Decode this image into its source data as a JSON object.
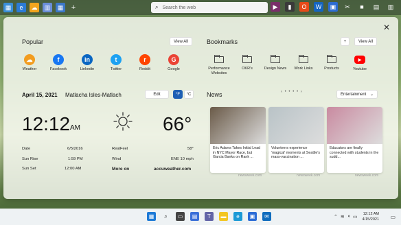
{
  "topbar": {
    "search_placeholder": "Search the web",
    "add_tab": "+"
  },
  "popular": {
    "title": "Popular",
    "view_all": "View All",
    "apps": [
      {
        "label": "Weather",
        "color": "#f29c1f",
        "glyph": "☁"
      },
      {
        "label": "Facebook",
        "color": "#1877f2",
        "glyph": "f"
      },
      {
        "label": "Linkedin",
        "color": "#0a66c2",
        "glyph": "in"
      },
      {
        "label": "Twitter",
        "color": "#1da1f2",
        "glyph": "t"
      },
      {
        "label": "Reddit",
        "color": "#ff4500",
        "glyph": "r"
      },
      {
        "label": "Google",
        "color": "#ea4335",
        "glyph": "G"
      }
    ]
  },
  "bookmarks": {
    "title": "Bookmarks",
    "add": "+",
    "view_all": "View All",
    "items": [
      {
        "label": "Performance Websites"
      },
      {
        "label": "OKR's"
      },
      {
        "label": "Design News"
      },
      {
        "label": "Work Links"
      },
      {
        "label": "Products"
      },
      {
        "label": "Youtube"
      }
    ]
  },
  "weather": {
    "date": "April 15, 2021",
    "location": "Matlacha Isles-Matlach",
    "edit": "Edit",
    "unit_f": "°F",
    "unit_c": "°C",
    "time": "12:12",
    "ampm": "AM",
    "temp": "66°",
    "left_rows": [
      {
        "label": "Date",
        "value": "6/5/2016"
      },
      {
        "label": "Sun Rise",
        "value": "1:59 PM"
      },
      {
        "label": "Sun Set",
        "value": "12:00 AM"
      }
    ],
    "right_rows": [
      {
        "label": "RealFeel",
        "value": "58°"
      },
      {
        "label": "Wind",
        "value": "ENE 10 mph"
      }
    ],
    "more_on": "More on",
    "source": "accuweather.com"
  },
  "news": {
    "title": "News",
    "dots": "‹ • • • • ›",
    "category": "Entertainment",
    "cards": [
      {
        "headline": "Eric Adams Takes Initial Lead in NYC Mayor Race, but Garcia Banks on Rank ...",
        "source": "newsweek.com",
        "img_color": "#6a5a48"
      },
      {
        "headline": "Volunteers experience 'magical' moments at Seattle's mass-vaccination ...",
        "source": "newsweek.com",
        "img_color": "#b9c3c7"
      },
      {
        "headline": "Educators are finally connected with students in the sudd...",
        "source": "newsweek.com",
        "img_color": "#c98aa0"
      }
    ]
  },
  "taskbar": {
    "time": "12:12 AM",
    "date": "4/15/2021"
  }
}
